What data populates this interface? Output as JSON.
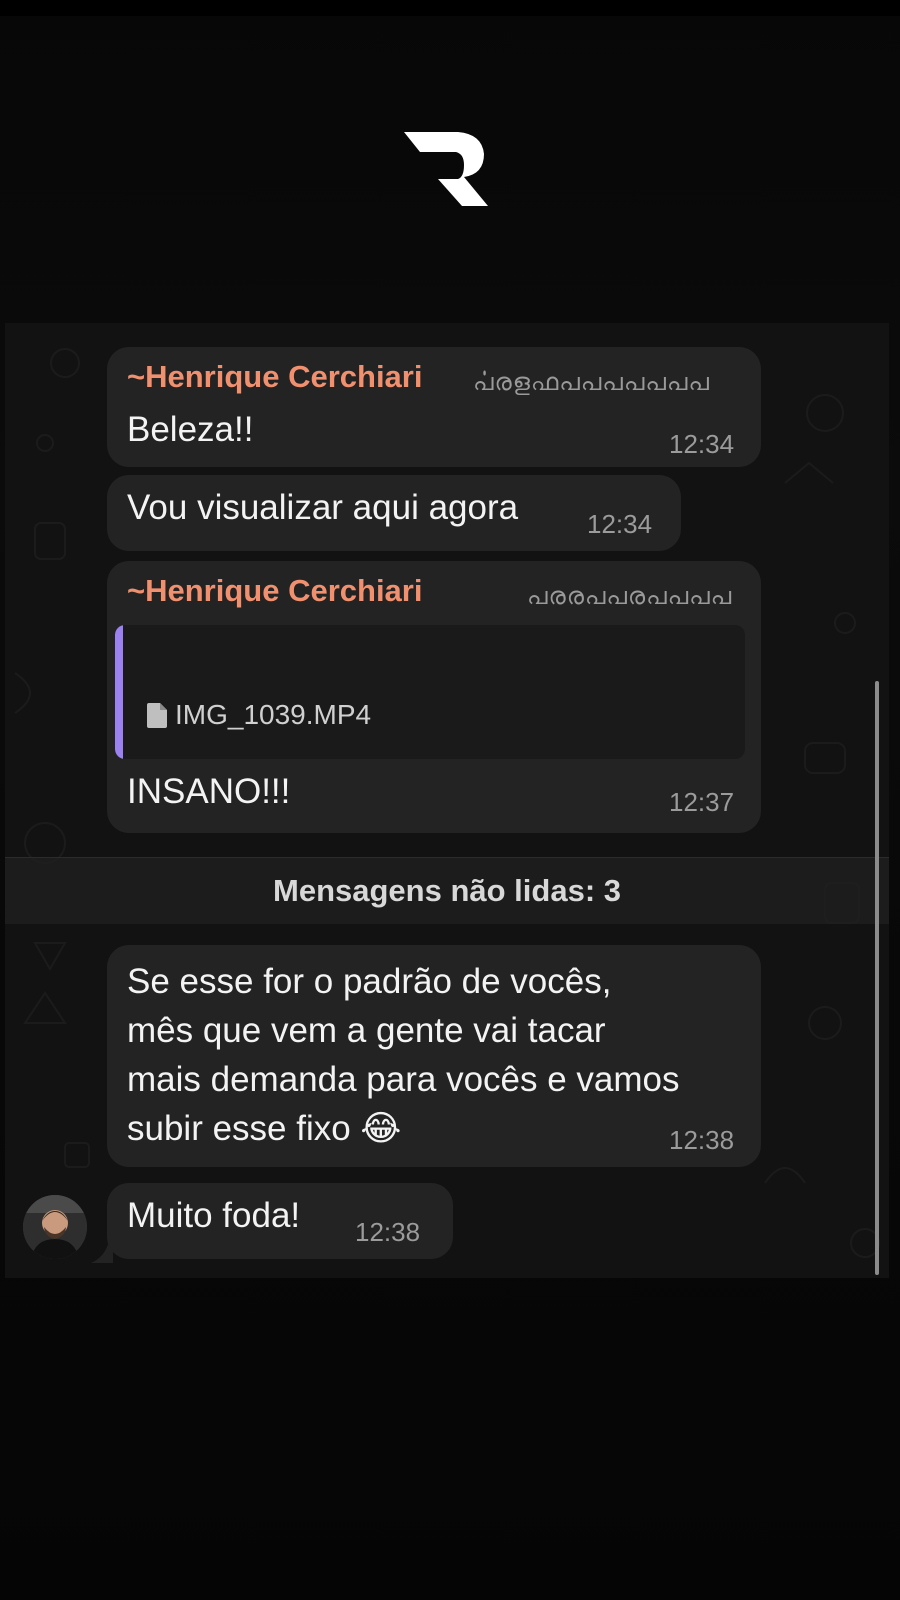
{
  "messages": [
    {
      "sender": "~Henrique Cerchiari",
      "phone_obscured": "ൎപരളഫപപപപപപപ",
      "text": "Beleza!!",
      "time": "12:34"
    },
    {
      "text": "Vou visualizar aqui agora",
      "time": "12:34"
    },
    {
      "sender": "~Henrique Cerchiari",
      "phone_obscured": "പരരപപരപപപപ",
      "quoted_file": "IMG_1039.MP4",
      "text": "INSANO!!!",
      "time": "12:37"
    },
    {
      "text_lines": [
        "Se esse for o padrão de vocês,",
        "mês que vem a gente vai tacar",
        "mais demanda para vocês e vamos",
        "subir esse fixo 😂"
      ],
      "time": "12:38"
    },
    {
      "text": "Muito foda!",
      "time": "12:38"
    }
  ],
  "unread_divider": "Mensagens não lidas: 3",
  "colors": {
    "sender": "#f0906f",
    "quote_accent": "#9c82f0",
    "bubble": "#232323"
  },
  "icons": [
    "logo-r",
    "file-icon",
    "avatar"
  ]
}
